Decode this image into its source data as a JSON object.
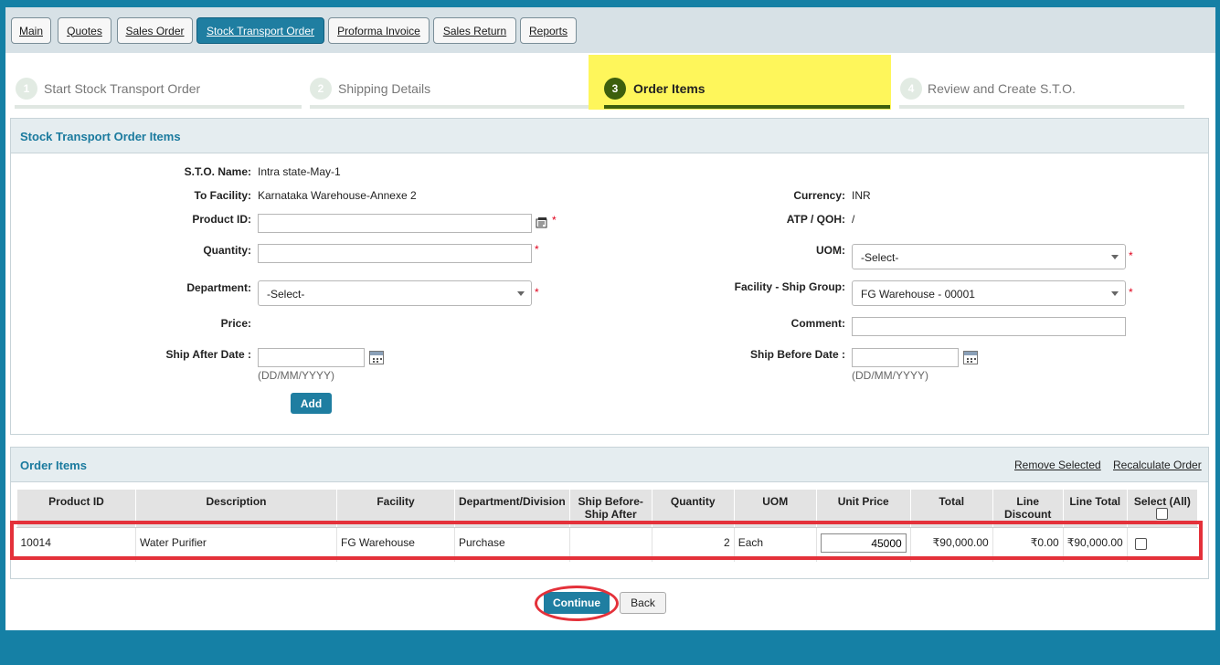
{
  "tabs": [
    {
      "label": "Main"
    },
    {
      "label": "Quotes"
    },
    {
      "label": "Sales Order"
    },
    {
      "label": "Stock Transport Order",
      "active": true
    },
    {
      "label": "Proforma Invoice"
    },
    {
      "label": "Sales Return"
    },
    {
      "label": "Reports"
    }
  ],
  "steps": [
    {
      "num": "1",
      "label": "Start Stock Transport Order"
    },
    {
      "num": "2",
      "label": "Shipping Details"
    },
    {
      "num": "3",
      "label": "Order Items",
      "active": true
    },
    {
      "num": "4",
      "label": "Review and Create S.T.O."
    }
  ],
  "items_form": {
    "title": "Stock Transport Order Items",
    "sto_name_label": "S.T.O. Name:",
    "sto_name_value": "Intra state-May-1",
    "to_facility_label": "To Facility:",
    "to_facility_value": "Karnataka Warehouse-Annexe 2",
    "currency_label": "Currency:",
    "currency_value": "INR",
    "product_id_label": "Product ID:",
    "product_id_value": "",
    "atp_qoh_label": "ATP / QOH:",
    "atp_qoh_value": "/",
    "quantity_label": "Quantity:",
    "quantity_value": "",
    "uom_label": "UOM:",
    "uom_value": "-Select-",
    "department_label": "Department:",
    "department_value": "-Select-",
    "ship_group_label": "Facility - Ship Group:",
    "ship_group_value": "FG Warehouse - 00001",
    "price_label": "Price:",
    "comment_label": "Comment:",
    "comment_value": "",
    "ship_after_label": "Ship After Date :",
    "ship_after_value": "",
    "ship_before_label": "Ship Before Date :",
    "ship_before_value": "",
    "date_hint": "(DD/MM/YYYY)",
    "required_mark": "*",
    "add_label": "Add"
  },
  "order_items": {
    "title": "Order Items",
    "remove_selected": "Remove Selected",
    "recalculate": "Recalculate Order",
    "columns": {
      "product_id": "Product ID",
      "description": "Description",
      "facility": "Facility",
      "department": "Department/Division",
      "ship_before": "Ship Before-",
      "ship_after": "Ship After",
      "quantity": "Quantity",
      "uom": "UOM",
      "unit_price": "Unit Price",
      "total": "Total",
      "line_discount_1": "Line",
      "line_discount_2": "Discount",
      "line_total": "Line Total",
      "select_all": "Select (All)"
    },
    "rows": [
      {
        "product_id": "10014",
        "description": "Water Purifier",
        "facility": "FG Warehouse",
        "department": "Purchase",
        "ship_dates": "",
        "quantity": "2",
        "uom": "Each",
        "unit_price": "45000",
        "total": "₹90,000.00",
        "line_discount": "₹0.00",
        "line_total": "₹90,000.00"
      }
    ]
  },
  "footer": {
    "continue_label": "Continue",
    "back_label": "Back"
  },
  "colors": {
    "background": "#1580a5",
    "accent": "#1f7ea1",
    "active_step": "#fef65b",
    "step_done": "#3d5f0d",
    "highlight": "#e4313a"
  }
}
